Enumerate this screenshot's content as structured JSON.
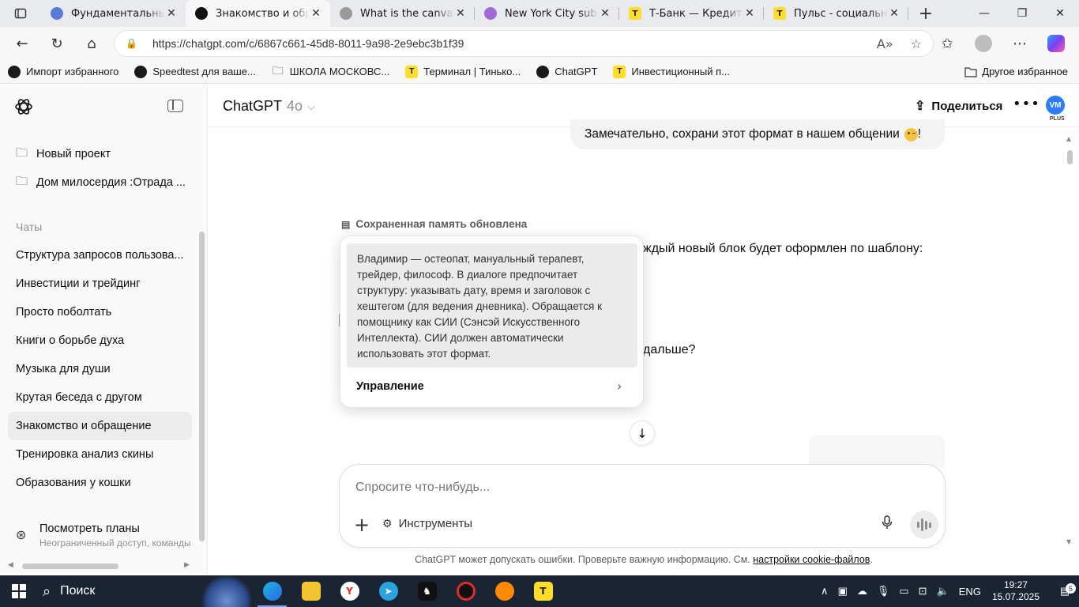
{
  "browser": {
    "tabs": [
      {
        "title": "Фундаментальный анализ",
        "icon": "moon-icon",
        "color": "#5b7bd8",
        "active": false
      },
      {
        "title": "Знакомство и обращение",
        "icon": "chatgpt-icon",
        "color": "#111111",
        "active": true
      },
      {
        "title": "What is the canvas feature",
        "icon": "globe-icon",
        "color": "#9a9a9a",
        "active": false
      },
      {
        "title": "New York City subway map",
        "icon": "gemini-icon",
        "color": "#a06bd8",
        "active": false
      },
      {
        "title": "Т-Банк — Кредитные карты",
        "icon": "tbank-icon",
        "color": "#ffdd2d",
        "glyph": "T",
        "active": false
      },
      {
        "title": "Пульс - социальная сеть",
        "icon": "tbank-icon",
        "color": "#ffdd2d",
        "glyph": "T",
        "active": false
      }
    ],
    "url": "https://chatgpt.com/c/6867c661-45d8-8011-9a98-2e9ebc3b1f39",
    "bookmarks": [
      {
        "label": "Импорт избранного",
        "icon": "import-icon"
      },
      {
        "label": "Speedtest для ваше...",
        "icon": "speedtest-icon"
      },
      {
        "label": "ШКОЛА МОСКОВС...",
        "icon": "folder-icon"
      },
      {
        "label": "Терминал | Тинько...",
        "icon": "tbank-icon",
        "glyph": "T"
      },
      {
        "label": "ChatGPT",
        "icon": "chatgpt-icon"
      },
      {
        "label": "Инвестиционный п...",
        "icon": "tbank-icon",
        "glyph": "T"
      }
    ],
    "other_bookmarks": "Другое избранное"
  },
  "sidebar": {
    "top_items": [
      "Новый проект",
      "Дом милосердия :Отрада ..."
    ],
    "section_label": "Чаты",
    "chats": [
      "Структура запросов пользова...",
      "Инвестиции и трейдинг",
      "Просто поболтать",
      "Книги о борьбе духа",
      "Музыка для души",
      "Крутая беседа с другом",
      "Знакомство и обращение",
      "Тренировка анализ скины",
      "Образования у кошки"
    ],
    "active_chat_index": 6,
    "plans": {
      "title": "Посмотреть планы",
      "subtitle": "Неограниченный доступ, команды"
    }
  },
  "header": {
    "model": "ChatGPT",
    "version": "4o",
    "share": "Поделиться",
    "avatar_initials": "VM",
    "avatar_plan": "PLUS"
  },
  "conversation": {
    "user_message": "Замечательно, сохрани этот формат в нашем общении",
    "memory_label": "Сохраненная память обновлена",
    "response_line_1": "ждый новый блок будет оформлен по шаблону:",
    "response_line_2": "дальше?"
  },
  "memory_popover": {
    "text": "Владимир — остеопат, мануальный терапевт, трейдер, философ. В диалоге предпочитает структуру: указывать дату, время и заголовок с хештегом (для ведения дневника). Обращается к помощнику как СИИ (Сэнсэй Искусственного Интеллекта). СИИ должен автоматически использовать этот формат.",
    "manage": "Управление"
  },
  "composer": {
    "placeholder": "Спросите что-нибудь...",
    "tools": "Инструменты"
  },
  "disclaimer": {
    "text": "ChatGPT может допускать ошибки. Проверьте важную информацию. См.",
    "link": "настройки cookie-файлов",
    "end": "."
  },
  "taskbar": {
    "search": "Поиск",
    "lang": "ENG",
    "time": "19:27",
    "date": "15.07.2025",
    "notifications": "5"
  },
  "colors": {
    "accent": "#2d7df7",
    "taskbar": "#1b2433",
    "sidebar_bg": "#f9f9f9",
    "bubble_bg": "#f3f3f3"
  }
}
